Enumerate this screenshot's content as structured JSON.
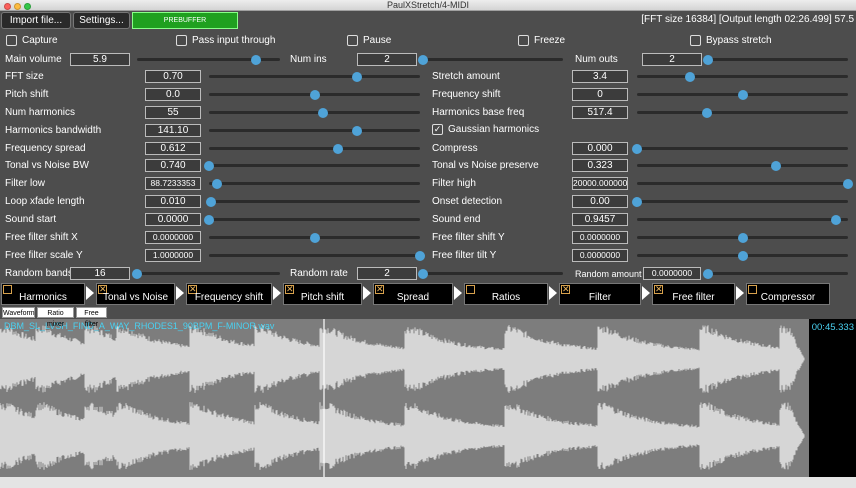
{
  "window": {
    "title": "PaulXStretch/4-MIDI"
  },
  "toolbar": {
    "import": "Import file...",
    "settings": "Settings...",
    "prebuffer": "PREBUFFER",
    "info": "[FFT size 16384] [Output length 02:26.499] 57.5"
  },
  "toggles": [
    {
      "label": "Capture",
      "checked": false
    },
    {
      "label": "Pass input through",
      "checked": false
    },
    {
      "label": "Pause",
      "checked": false
    },
    {
      "label": "Freeze",
      "checked": false
    },
    {
      "label": "Bypass stretch",
      "checked": false
    }
  ],
  "top_params": [
    {
      "label": "Main volume",
      "value": "5.9",
      "pos": 0.83
    },
    {
      "label": "Num ins",
      "value": "2",
      "pos": 0.0
    },
    {
      "label": "Num outs",
      "value": "2",
      "pos": 0.0
    }
  ],
  "left_params": [
    {
      "label": "FFT size",
      "value": "0.70",
      "pos": 0.7
    },
    {
      "label": "Pitch shift",
      "value": "0.0",
      "pos": 0.5
    },
    {
      "label": "Num harmonics",
      "value": "55",
      "pos": 0.54
    },
    {
      "label": "Harmonics bandwidth",
      "value": "141.10",
      "pos": 0.7
    },
    {
      "label": "Frequency spread",
      "value": "0.612",
      "pos": 0.61
    },
    {
      "label": "Tonal vs Noise BW",
      "value": "0.740",
      "pos": 0.0
    },
    {
      "label": "Filter low",
      "value": "88.7233353",
      "pos": 0.04
    },
    {
      "label": "Loop xfade length",
      "value": "0.010",
      "pos": 0.01
    },
    {
      "label": "Sound start",
      "value": "0.0000",
      "pos": 0.0
    },
    {
      "label": "Free filter shift X",
      "value": "0.0000000",
      "pos": 0.5
    },
    {
      "label": "Free filter scale Y",
      "value": "1.0000000",
      "pos": 1.0
    }
  ],
  "right_params": [
    {
      "label": "Stretch amount",
      "value": "3.4",
      "pos": 0.25
    },
    {
      "label": "Frequency shift",
      "value": "0",
      "pos": 0.5
    },
    {
      "label": "Harmonics base freq",
      "value": "517.4",
      "pos": 0.33
    },
    {
      "label": "Gaussian harmonics",
      "checked": true
    },
    {
      "label": "Compress",
      "value": "0.000",
      "pos": 0.0
    },
    {
      "label": "Tonal vs Noise preserve",
      "value": "0.323",
      "pos": 0.66
    },
    {
      "label": "Filter high",
      "value": "20000.0000000",
      "pos": 1.0
    },
    {
      "label": "Onset detection",
      "value": "0.00",
      "pos": 0.0
    },
    {
      "label": "Sound end",
      "value": "0.9457",
      "pos": 0.945
    },
    {
      "label": "Free filter shift Y",
      "value": "0.0000000",
      "pos": 0.5
    },
    {
      "label": "Free filter tilt Y",
      "value": "0.0000000",
      "pos": 0.5
    }
  ],
  "bottom_params": [
    {
      "label": "Random bands",
      "value": "16",
      "pos": 0.0
    },
    {
      "label": "Random rate",
      "value": "2",
      "pos": 0.0
    },
    {
      "label": "Random amount",
      "value": "0.0000000",
      "pos": 0.0
    }
  ],
  "chain": [
    {
      "label": "Harmonics",
      "enabled": false
    },
    {
      "label": "Tonal vs Noise",
      "enabled": true
    },
    {
      "label": "Frequency shift",
      "enabled": true
    },
    {
      "label": "Pitch shift",
      "enabled": true
    },
    {
      "label": "Spread",
      "enabled": true
    },
    {
      "label": "Ratios",
      "enabled": false
    },
    {
      "label": "Filter",
      "enabled": true
    },
    {
      "label": "Free filter",
      "enabled": true
    },
    {
      "label": "Compressor",
      "enabled": false
    }
  ],
  "tabs": [
    "Waveform",
    "Ratio mixer",
    "Free filter"
  ],
  "waveform": {
    "filename": "DBM_SL_LVSH_FIND_A_WAY_RHODES1_90BPM_F-MINOR.wav",
    "time": "00:45.333",
    "playhead": 0.38
  },
  "colors": {
    "accent": "#4fa3d8",
    "prebuffer": "#1fa01f",
    "wave_text": "#49d1f1"
  }
}
